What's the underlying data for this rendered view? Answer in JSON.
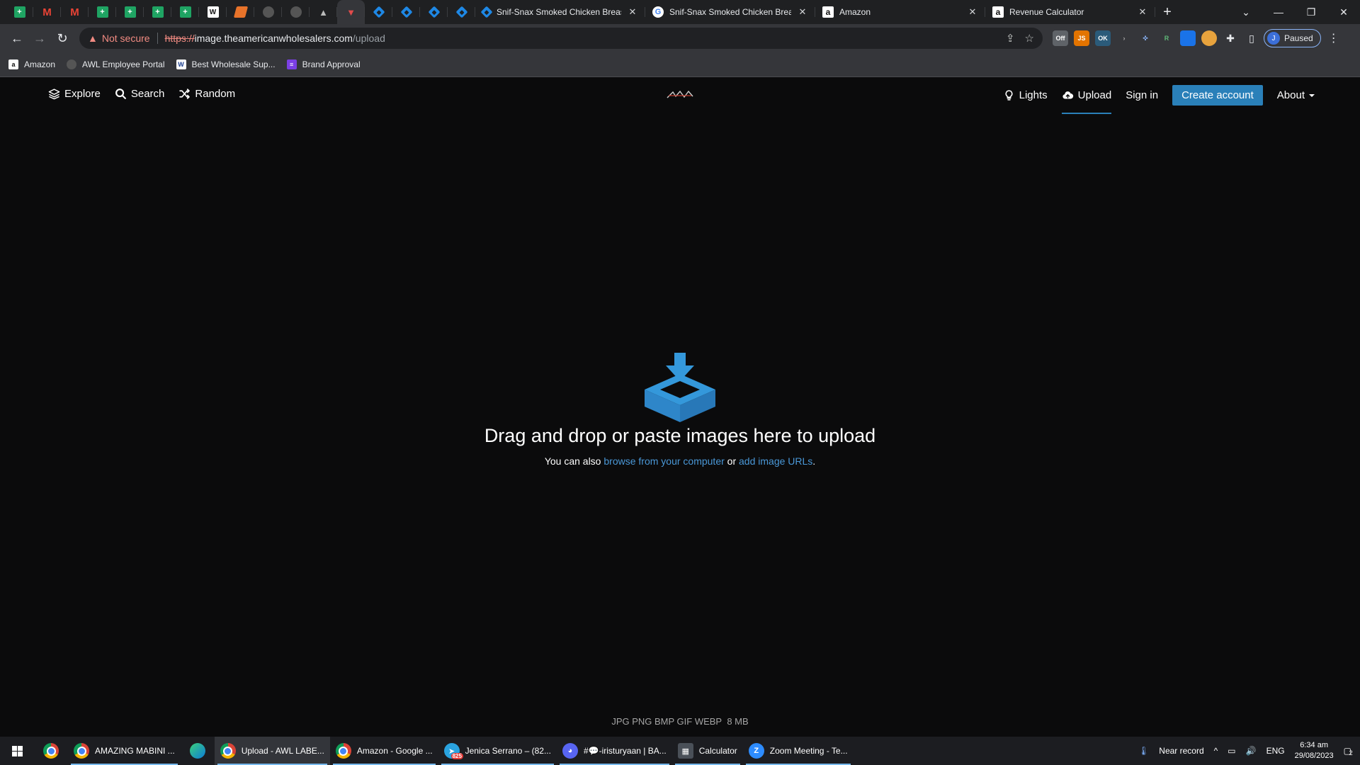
{
  "browser": {
    "tabs": [
      {
        "title": "Snif-Snax Smoked Chicken Breast",
        "icon": "diamond-icon"
      },
      {
        "title": "Snif-Snax Smoked Chicken Breast",
        "icon": "google-icon"
      },
      {
        "title": "Amazon",
        "icon": "amazon-icon"
      },
      {
        "title": "Revenue Calculator",
        "icon": "amazon-icon"
      }
    ],
    "address": {
      "security_label": "Not secure",
      "protocol": "https://",
      "host": "image.theamericanwholesalers.com",
      "path": "/upload"
    },
    "profile": {
      "initial": "J",
      "status": "Paused"
    },
    "extensions": [
      {
        "label": "Off",
        "color": "#5f6368"
      },
      {
        "label": "JS",
        "color": "#e37400"
      },
      {
        "label": "OK",
        "color": "#2b5b7a"
      }
    ],
    "bookmarks": [
      {
        "label": "Amazon"
      },
      {
        "label": "AWL Employee Portal"
      },
      {
        "label": "Best Wholesale Sup..."
      },
      {
        "label": "Brand Approval"
      }
    ]
  },
  "site": {
    "nav_left": [
      {
        "label": "Explore",
        "icon": "layers-icon"
      },
      {
        "label": "Search",
        "icon": "search-icon"
      },
      {
        "label": "Random",
        "icon": "shuffle-icon"
      }
    ],
    "nav_right": {
      "lights": "Lights",
      "upload": "Upload",
      "signin": "Sign in",
      "create": "Create account",
      "about": "About"
    },
    "upload": {
      "headline": "Drag and drop or paste images here to upload",
      "sub_prefix": "You can also",
      "browse_link": "browse from your computer",
      "sub_or": "or",
      "urls_link": "add image URLs",
      "sub_suffix": ".",
      "formats": "JPG PNG BMP GIF WEBP",
      "max_size": "8 MB"
    },
    "accent_color": "#2a80b9"
  },
  "taskbar": {
    "apps": [
      {
        "label": "AMAZING MABINI ...",
        "icon": "chrome-icon",
        "active": false
      },
      {
        "label": "Upload - AWL LABE...",
        "icon": "chrome-icon",
        "active": true
      },
      {
        "label": "Amazon - Google ...",
        "icon": "chrome-icon",
        "active": false
      },
      {
        "label": "Jenica Serrano – (82...",
        "icon": "telegram-icon",
        "active": false
      },
      {
        "label": "#💬-iristuryaan | BA...",
        "icon": "discord-icon",
        "active": false
      },
      {
        "label": "Calculator",
        "icon": "calculator-icon",
        "active": false
      },
      {
        "label": "Zoom Meeting - Te...",
        "icon": "zoom-icon",
        "active": false
      }
    ],
    "telegram_badge": "825",
    "weather": "Near record",
    "language": "ENG",
    "time": "6:34 am",
    "date": "29/08/2023",
    "notifications": "2"
  }
}
